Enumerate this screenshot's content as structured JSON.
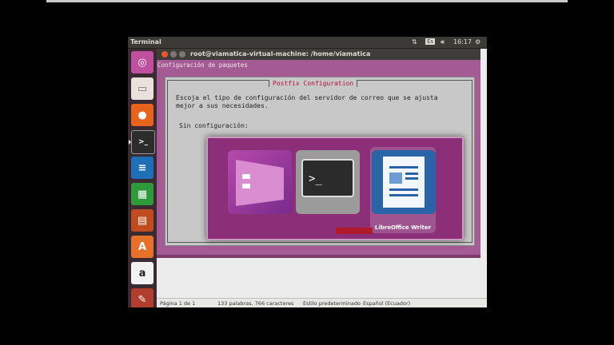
{
  "panel": {
    "app_title": "Terminal",
    "clock": "16:17",
    "keyboard_indicator": "Es"
  },
  "terminal": {
    "window_title": "root@viamatica-virtual-machine: /home/viamatica",
    "subtitle": "Configuración de paquetes"
  },
  "dialog": {
    "title": "Postfix Configuration",
    "body": "Escoja el tipo de configuración del servidor de correo que se ajusta\nmejor a sus necesidades.",
    "option_first": "Sin configuración:"
  },
  "switcher": {
    "selected_label": "LibreOffice Writer",
    "apps": [
      "LibreOffice Impress",
      "Terminal",
      "LibreOffice Writer"
    ]
  },
  "writer_status": {
    "page": "Página 1 de 1",
    "words": "133 palabras, 766 caracteres",
    "style": "Estilo predeterminado",
    "language": "Español (Ecuador)"
  },
  "colors": {
    "launcher_bg": "#3a2b33",
    "terminal_bg": "#a45a93",
    "switcher_bg": "#8a2f78",
    "dialog_title": "#b0123a"
  },
  "launcher_icons": [
    "ubuntu-dash-icon",
    "files-icon",
    "firefox-icon",
    "terminal-icon",
    "writer-icon",
    "calc-icon",
    "impress-icon",
    "software-center-icon",
    "amazon-icon",
    "settings-icon"
  ]
}
